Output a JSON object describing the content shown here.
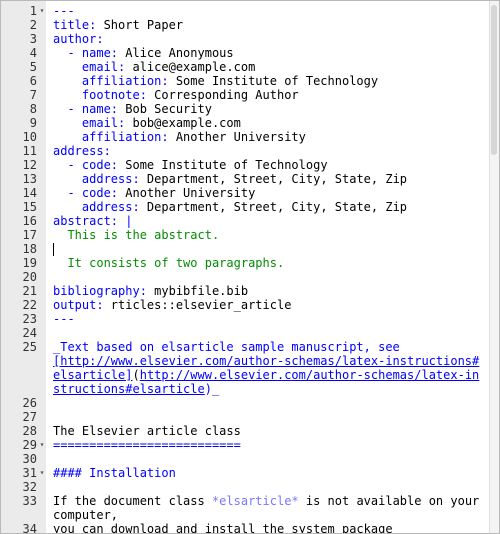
{
  "editor": {
    "lines": [
      {
        "n": "1",
        "fold": "▾",
        "segs": [
          {
            "t": "---",
            "c": "k"
          }
        ]
      },
      {
        "n": "2",
        "segs": [
          {
            "t": "title:",
            "c": "k"
          },
          {
            "t": " Short Paper"
          }
        ]
      },
      {
        "n": "3",
        "segs": [
          {
            "t": "author:",
            "c": "k"
          }
        ]
      },
      {
        "n": "4",
        "segs": [
          {
            "t": "  - name:",
            "c": "k"
          },
          {
            "t": " Alice Anonymous"
          }
        ]
      },
      {
        "n": "5",
        "segs": [
          {
            "t": "    email:",
            "c": "k"
          },
          {
            "t": " alice@example.com"
          }
        ]
      },
      {
        "n": "6",
        "segs": [
          {
            "t": "    affiliation:",
            "c": "k"
          },
          {
            "t": " Some Institute of Technology"
          }
        ]
      },
      {
        "n": "7",
        "segs": [
          {
            "t": "    footnote:",
            "c": "k"
          },
          {
            "t": " Corresponding Author"
          }
        ]
      },
      {
        "n": "8",
        "segs": [
          {
            "t": "  - name:",
            "c": "k"
          },
          {
            "t": " Bob Security"
          }
        ]
      },
      {
        "n": "9",
        "segs": [
          {
            "t": "    email:",
            "c": "k"
          },
          {
            "t": " bob@example.com"
          }
        ]
      },
      {
        "n": "10",
        "segs": [
          {
            "t": "    affiliation:",
            "c": "k"
          },
          {
            "t": " Another University"
          }
        ]
      },
      {
        "n": "11",
        "segs": [
          {
            "t": "address:",
            "c": "k"
          }
        ]
      },
      {
        "n": "12",
        "segs": [
          {
            "t": "  - code:",
            "c": "k"
          },
          {
            "t": " Some Institute of Technology"
          }
        ]
      },
      {
        "n": "13",
        "segs": [
          {
            "t": "    address:",
            "c": "k"
          },
          {
            "t": " Department, Street, City, State, Zip"
          }
        ]
      },
      {
        "n": "14",
        "segs": [
          {
            "t": "  - code:",
            "c": "k"
          },
          {
            "t": " Another University"
          }
        ]
      },
      {
        "n": "15",
        "segs": [
          {
            "t": "    address:",
            "c": "k"
          },
          {
            "t": " Department, Street, City, State, Zip"
          }
        ]
      },
      {
        "n": "16",
        "segs": [
          {
            "t": "abstract:",
            "c": "k"
          },
          {
            "t": " |",
            "c": "k"
          }
        ]
      },
      {
        "n": "17",
        "segs": [
          {
            "t": "  This is the abstract.",
            "c": "s"
          }
        ]
      },
      {
        "n": "18",
        "cursor": true,
        "segs": []
      },
      {
        "n": "19",
        "segs": [
          {
            "t": "  It consists of two paragraphs.",
            "c": "s"
          }
        ]
      },
      {
        "n": "20",
        "segs": []
      },
      {
        "n": "21",
        "segs": [
          {
            "t": "bibliography:",
            "c": "k"
          },
          {
            "t": " mybibfile.bib"
          }
        ]
      },
      {
        "n": "22",
        "segs": [
          {
            "t": "output:",
            "c": "k"
          },
          {
            "t": " rticles::elsevier_article"
          }
        ]
      },
      {
        "n": "23",
        "segs": [
          {
            "t": "---",
            "c": "k"
          }
        ]
      },
      {
        "n": "24",
        "segs": []
      },
      {
        "n": "25",
        "segs": [
          {
            "t": "_Text based on elsarticle sample manuscript, see",
            "c": "k"
          }
        ]
      },
      {
        "n": "",
        "segs": [
          {
            "t": "[http://www.elsevier.com/author-schemas/latex-instructions#",
            "c": "lnk"
          }
        ]
      },
      {
        "n": "",
        "segs": [
          {
            "t": "elsarticle]",
            "c": "lnk"
          },
          {
            "t": "("
          },
          {
            "t": "http://www.elsevier.com/author-schemas/latex-in",
            "c": "lnk"
          }
        ]
      },
      {
        "n": "",
        "segs": [
          {
            "t": "structions#elsarticle",
            "c": "lnk"
          },
          {
            "t": ")_",
            "c": "k"
          }
        ]
      },
      {
        "n": "26",
        "segs": []
      },
      {
        "n": "27",
        "segs": []
      },
      {
        "n": "28",
        "segs": [
          {
            "t": "The Elsevier article class"
          }
        ]
      },
      {
        "n": "29",
        "fold": "▾",
        "segs": [
          {
            "t": "==========================",
            "c": "hdr"
          }
        ]
      },
      {
        "n": "30",
        "segs": []
      },
      {
        "n": "31",
        "fold": "▾",
        "segs": [
          {
            "t": "#### Installation",
            "c": "hdr"
          }
        ]
      },
      {
        "n": "32",
        "segs": []
      },
      {
        "n": "33",
        "segs": [
          {
            "t": "If the document class "
          },
          {
            "t": "*elsarticle*",
            "c": "it"
          },
          {
            "t": " is not available on your"
          }
        ]
      },
      {
        "n": "",
        "segs": [
          {
            "t": "computer,"
          }
        ]
      },
      {
        "n": "34",
        "segs": [
          {
            "t": "you can download and install the system package"
          }
        ]
      }
    ]
  }
}
